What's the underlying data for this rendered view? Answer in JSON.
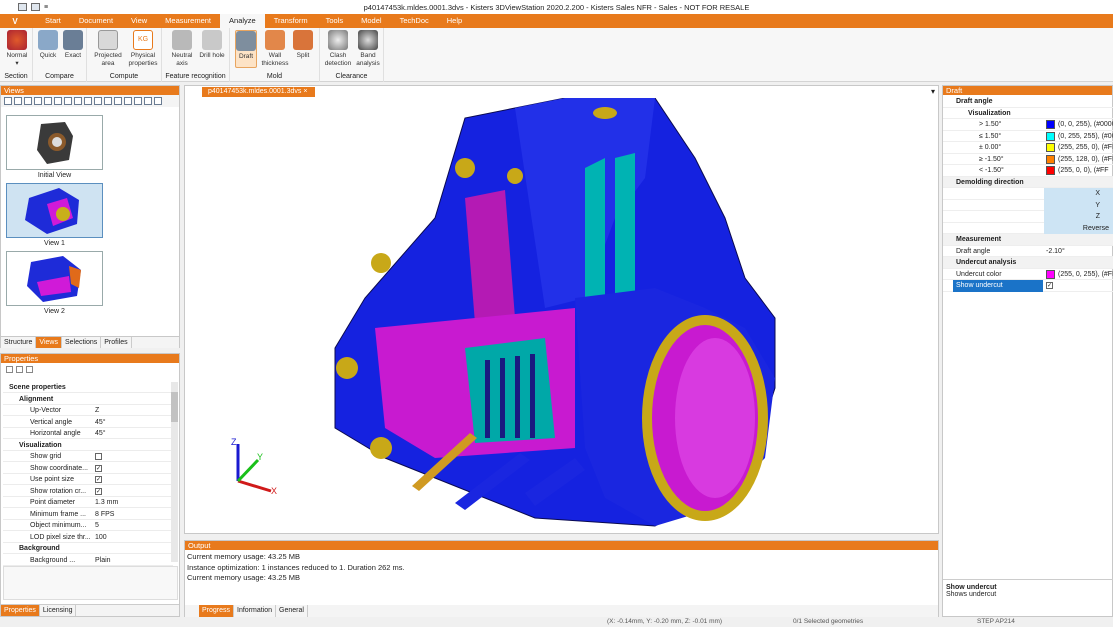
{
  "titlebar": {
    "title": "p40147453k.mldes.0001.3dvs - Kisters 3DViewStation 2020.2.200 - Kisters Sales NFR - Sales - NOT FOR RESALE"
  },
  "menu": {
    "app": "V",
    "tabs": [
      "Start",
      "Document",
      "View",
      "Measurement",
      "Analyze",
      "Transform",
      "Tools",
      "Model",
      "TechDoc",
      "Help"
    ],
    "active": "Analyze"
  },
  "ribbon": {
    "groups": [
      {
        "label": "Section",
        "buttons": [
          "Normal"
        ]
      },
      {
        "label": "Compare",
        "buttons": [
          "Quick",
          "Exact"
        ]
      },
      {
        "label": "Compute",
        "buttons": [
          "Projected area",
          "Physical properties"
        ]
      },
      {
        "label": "Feature recognition",
        "buttons": [
          "Neutral axis",
          "Drill hole"
        ]
      },
      {
        "label": "Mold",
        "buttons": [
          "Draft",
          "Wall thickness",
          "Split"
        ]
      },
      {
        "label": "Clearance",
        "buttons": [
          "Clash detection",
          "Band analysis"
        ]
      }
    ]
  },
  "views": {
    "title": "Views",
    "items": [
      "Initial View",
      "View 1",
      "View 2"
    ],
    "tabs": [
      "Structure",
      "Views",
      "Selections",
      "Profiles"
    ]
  },
  "properties": {
    "title": "Properties",
    "rows": [
      {
        "type": "cat",
        "key": "Scene properties"
      },
      {
        "type": "sub",
        "key": "Alignment"
      },
      {
        "key": "Up-Vector",
        "value": "Z"
      },
      {
        "key": "Vertical angle",
        "value": "45°"
      },
      {
        "key": "Horizontal angle",
        "value": "45°"
      },
      {
        "type": "sub",
        "key": "Visualization"
      },
      {
        "key": "Show grid",
        "check": ""
      },
      {
        "key": "Show coordinate...",
        "check": "✓"
      },
      {
        "key": "Use point size",
        "check": "✓"
      },
      {
        "key": "Show rotation cr...",
        "check": "✓"
      },
      {
        "key": "Point diameter",
        "value": "1.3 mm"
      },
      {
        "key": "Minimum frame ...",
        "value": "8 FPS"
      },
      {
        "key": "Object minimum...",
        "value": "5"
      },
      {
        "key": "LOD pixel size thr...",
        "value": "100"
      },
      {
        "type": "sub",
        "key": "Background"
      },
      {
        "key": "Background ...",
        "value": "Plain"
      }
    ],
    "tabs": [
      "Properties",
      "Licensing"
    ]
  },
  "viewport": {
    "tab": "p40147453k.mldes.0001.3dvs",
    "axes": [
      "X",
      "Y",
      "Z"
    ]
  },
  "output": {
    "title": "Output",
    "lines": [
      "Current memory usage: 43.25 MB",
      "Instance optimization: 1 instances reduced to 1. Duration 262 ms.",
      "Current memory usage: 43.25 MB"
    ],
    "tabs": [
      "Progress",
      "Information",
      "General"
    ]
  },
  "draft": {
    "title": "Draft",
    "section": "Draft angle",
    "vis": "Visualization",
    "rows": [
      {
        "k": "> 1.50°",
        "v": "(0, 0, 255), (#0000",
        "c": "#0000ff"
      },
      {
        "k": "≤ 1.50°",
        "v": "(0, 255, 255), (#00",
        "c": "#00ffff"
      },
      {
        "k": "± 0.00°",
        "v": "(255, 255, 0), (#FF",
        "c": "#ffff00"
      },
      {
        "k": "≥ -1.50°",
        "v": "(255, 128, 0), (#FF",
        "c": "#ff8000"
      },
      {
        "k": "< -1.50°",
        "v": "(255, 0, 0), (#FF",
        "c": "#ff0000"
      }
    ],
    "demold": "Demolding direction",
    "dirs": [
      "X",
      "Y",
      "Z",
      "Reverse"
    ],
    "measure": "Measurement",
    "angleKey": "Draft angle",
    "angleVal": "-2.10°",
    "undercut": "Undercut analysis",
    "ucColorKey": "Undercut color",
    "ucColorVal": "(255, 0, 255), (#FF",
    "ucColor": "#ff00ff",
    "showUc": "Show undercut",
    "helpTitle": "Show undercut",
    "helpText": "Shows undercut"
  },
  "status": {
    "coords": "(X: -0.14mm, Y: -0.20 mm, Z: -0.01 mm)",
    "sel": "0/1 Selected geometries",
    "fmt": "STEP AP214"
  }
}
